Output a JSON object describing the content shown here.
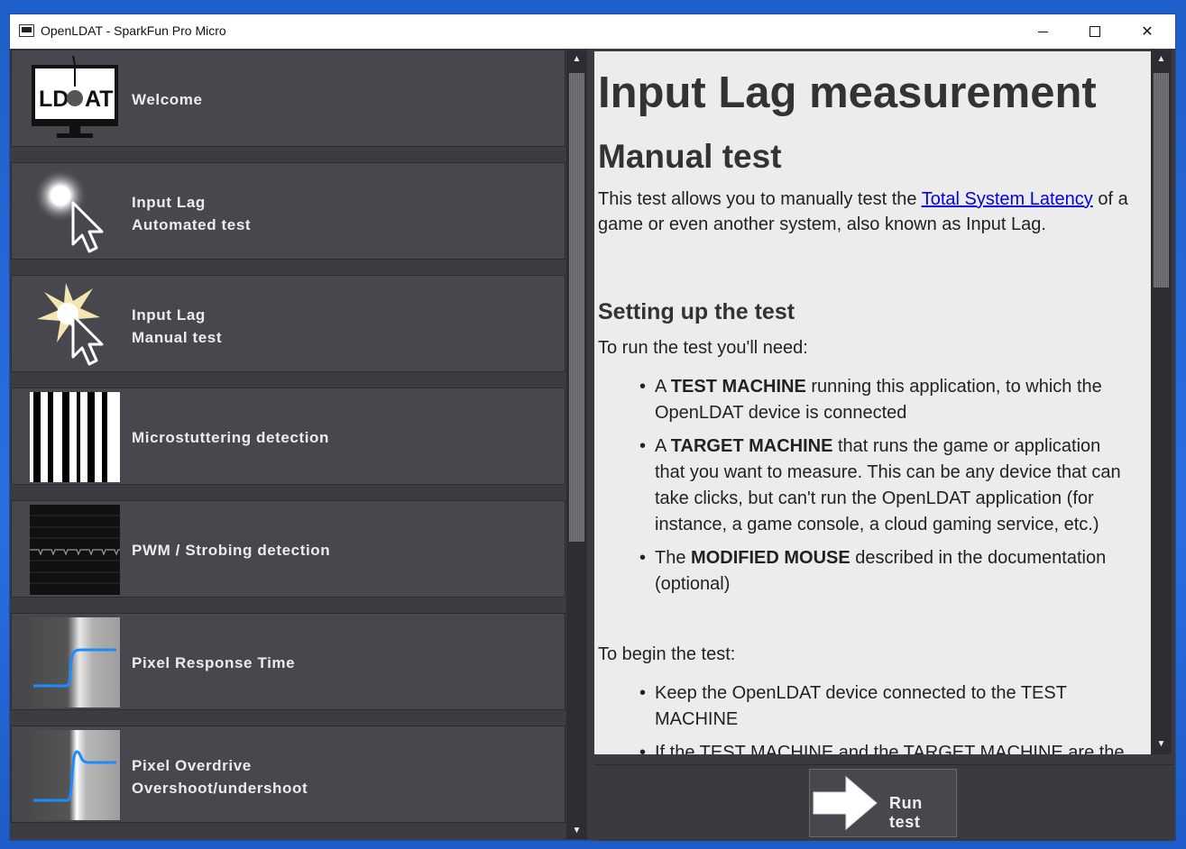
{
  "window": {
    "title": "OpenLDAT - SparkFun Pro Micro"
  },
  "menu": {
    "items": [
      {
        "line1": "Welcome",
        "line2": "",
        "icon": "ldat-monitor-icon"
      },
      {
        "line1": "Input Lag",
        "line2": "Automated test",
        "icon": "glow-cursor-icon"
      },
      {
        "line1": "Input Lag",
        "line2": "Manual test",
        "icon": "flash-cursor-icon"
      },
      {
        "line1": "Microstuttering detection",
        "line2": "",
        "icon": "bars-icon"
      },
      {
        "line1": "PWM / Strobing detection",
        "line2": "",
        "icon": "waveform-icon"
      },
      {
        "line1": "Pixel Response Time",
        "line2": "",
        "icon": "response-curve-icon"
      },
      {
        "line1": "Pixel Overdrive",
        "line2": "Overshoot/undershoot",
        "icon": "overshoot-curve-icon"
      }
    ]
  },
  "content": {
    "title": "Input Lag measurement",
    "subtitle": "Manual test",
    "intro_before": "This test allows you to manually test the ",
    "intro_link": "Total System Latency",
    "intro_after": " of a game or even another system, also known as Input Lag.",
    "setup_heading": "Setting up the test",
    "need_text": "To run the test you'll need:",
    "requirements": [
      {
        "prefix": "A ",
        "bold": "TEST MACHINE",
        "rest": " running this application, to which the OpenLDAT device is connected"
      },
      {
        "prefix": "A ",
        "bold": "TARGET MACHINE",
        "rest": " that runs the game or application that you want to measure. This can be any device that can take clicks, but can't run the OpenLDAT application (for instance, a game console, a cloud gaming service, etc.)"
      },
      {
        "prefix": "The ",
        "bold": "MODIFIED MOUSE",
        "rest": " described in the documentation (optional)"
      }
    ],
    "begin_text": "To begin the test:",
    "begin_steps": [
      "Keep the OpenLDAT device connected to the TEST MACHINE",
      "If the TEST MACHINE and the TARGET MACHINE are the"
    ]
  },
  "actions": {
    "run_label": "Run test",
    "run_icon": "arrow-right-icon"
  }
}
